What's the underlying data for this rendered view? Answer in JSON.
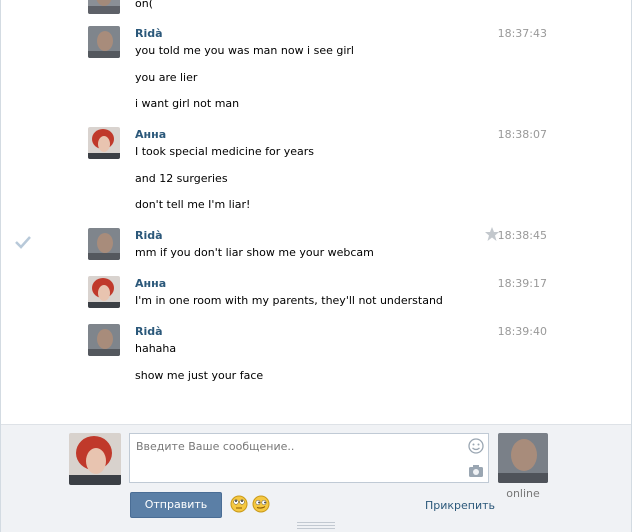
{
  "history": {
    "cut_off_text": "on(",
    "messages": [
      {
        "author": "Ridà",
        "time": "18:37:43",
        "lines": [
          "you told me you was man now i see girl",
          "you are lier",
          "i want girl not man"
        ]
      },
      {
        "author": "Анна",
        "time": "18:38:07",
        "lines": [
          "I took special medicine for years",
          "and 12 surgeries",
          "don't tell me I'm liar!"
        ]
      },
      {
        "author": "Ridà",
        "time": "18:38:45",
        "lines": [
          "mm if you don't liar show me your webcam"
        ]
      },
      {
        "author": "Анна",
        "time": "18:39:17",
        "lines": [
          "I'm in one room with my parents, they'll not understand"
        ]
      },
      {
        "author": "Ridà",
        "time": "18:39:40",
        "lines": [
          "hahaha",
          "show me just your face"
        ]
      }
    ]
  },
  "composer": {
    "placeholder": "Введите Ваше сообщение..",
    "send_label": "Отправить",
    "attach_label": "Прикрепить",
    "online_label": "online"
  },
  "icons": {
    "read_check": "check-icon",
    "star": "star-icon",
    "smile": "smile-icon",
    "camera": "camera-icon"
  },
  "colors": {
    "author_link": "#2b587a",
    "send_button": "#5b7fa6",
    "composer_bg": "#f0f2f5"
  }
}
